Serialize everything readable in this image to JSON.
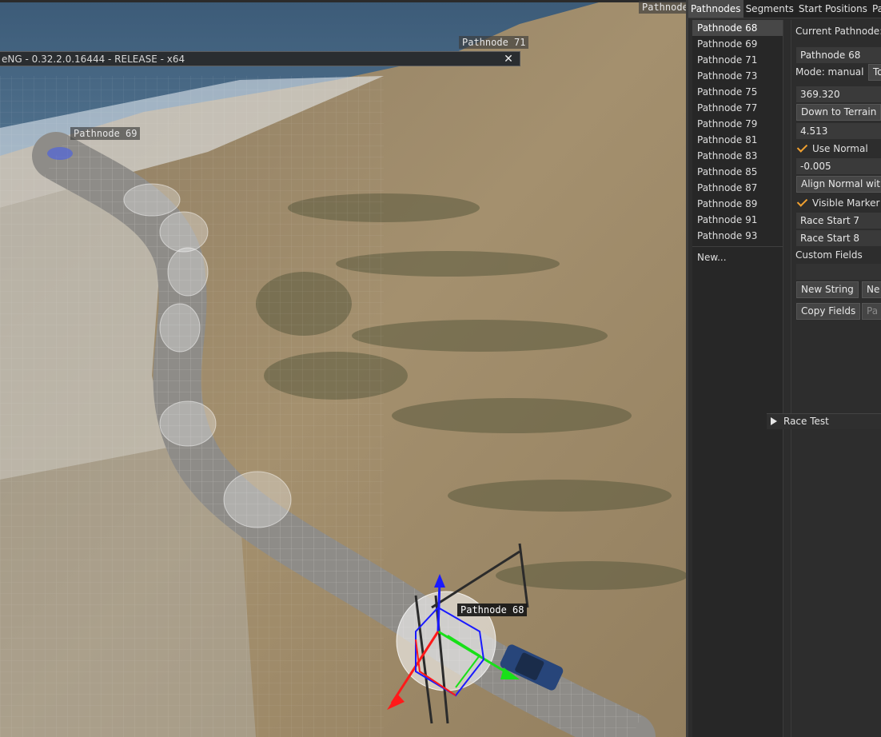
{
  "window": {
    "title": "eNG - 0.32.2.0.16444 - RELEASE - x64",
    "close_icon": "close-icon"
  },
  "viewport_labels": {
    "top": "Pathnode",
    "node71": "Pathnode 71",
    "node69": "Pathnode 69",
    "node68": "Pathnode 68"
  },
  "tabs": [
    "Pathnodes",
    "Segments",
    "Start Positions",
    "Pac"
  ],
  "list": {
    "items": [
      "Pathnode 68",
      "Pathnode 69",
      "Pathnode 71",
      "Pathnode 73",
      "Pathnode 75",
      "Pathnode 77",
      "Pathnode 79",
      "Pathnode 81",
      "Pathnode 83",
      "Pathnode 85",
      "Pathnode 87",
      "Pathnode 89",
      "Pathnode 91",
      "Pathnode 93"
    ],
    "new_label": "New..."
  },
  "detail": {
    "current_label": "Current Pathnode: #",
    "name_value": "Pathnode 68",
    "mode_label": "Mode: manual",
    "mode_button": "To",
    "radius_value": "369.320",
    "down_to_terrain": "Down to Terrain",
    "value_2": "4.513",
    "use_normal": "Use Normal",
    "value_3": "-0.005",
    "align_normal": "Align Normal with",
    "visible_marker": "Visible Marker",
    "race_start_7": "Race Start 7",
    "race_start_8": "Race Start 8",
    "custom_fields": "Custom Fields",
    "new_string": "New String",
    "new_other": "Ne",
    "copy_fields": "Copy Fields",
    "paste_fields": "Pa"
  },
  "race_test": {
    "label": "Race Test"
  },
  "colors": {
    "accent_check": "#f0a030",
    "panel_bg": "#2d2d2d"
  }
}
